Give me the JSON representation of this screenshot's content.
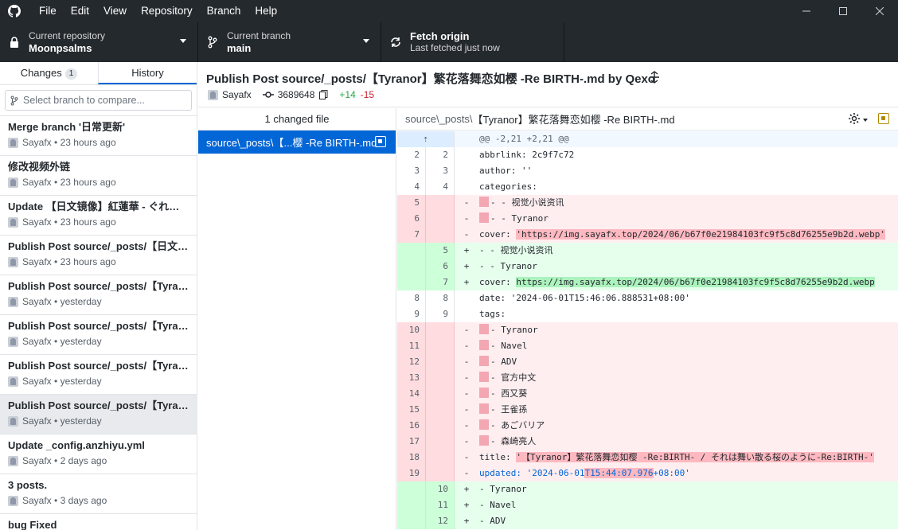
{
  "menu": {
    "items": [
      {
        "label": "File",
        "key": "F"
      },
      {
        "label": "Edit",
        "key": "E"
      },
      {
        "label": "View",
        "key": "V"
      },
      {
        "label": "Repository",
        "key": "R"
      },
      {
        "label": "Branch",
        "key": "B"
      },
      {
        "label": "Help",
        "key": "H"
      }
    ]
  },
  "toolbar": {
    "repo": {
      "desc": "Current repository",
      "value": "Moonpsalms"
    },
    "branch": {
      "desc": "Current branch",
      "value": "main"
    },
    "fetch": {
      "title": "Fetch origin",
      "desc": "Last fetched just now"
    }
  },
  "sidebar": {
    "tabs": [
      {
        "label": "Changes",
        "count": "1"
      },
      {
        "label": "History"
      }
    ],
    "selected_tab": "History",
    "branch_compare_placeholder": "Select branch to compare...",
    "commits": [
      {
        "summary": "Merge branch '日常更新'",
        "author": "Sayafx",
        "time": "23 hours ago"
      },
      {
        "summary": "修改视频外链",
        "author": "Sayafx",
        "time": "23 hours ago"
      },
      {
        "summary": "Update 【日文镜像】紅蓮華 - ぐれんか Gurenka…",
        "author": "Sayafx",
        "time": "23 hours ago"
      },
      {
        "summary": "Publish Post source/_posts/【日文镜像】…",
        "author": "Sayafx",
        "time": "23 hours ago"
      },
      {
        "summary": "Publish Post source/_posts/【Tyranor】…",
        "author": "Sayafx",
        "time": "yesterday"
      },
      {
        "summary": "Publish Post source/_posts/【Tyranor】…",
        "author": "Sayafx",
        "time": "yesterday"
      },
      {
        "summary": "Publish Post source/_posts/【Tyranor】…",
        "author": "Sayafx",
        "time": "yesterday"
      },
      {
        "summary": "Publish Post source/_posts/【Tyranor】…",
        "author": "Sayafx",
        "time": "yesterday",
        "selected": true
      },
      {
        "summary": "Update _config.anzhiyu.yml",
        "author": "Sayafx",
        "time": "2 days ago"
      },
      {
        "summary": "3 posts.",
        "author": "Sayafx",
        "time": "3 days ago"
      },
      {
        "summary": "bug Fixed",
        "author": "",
        "time": ""
      }
    ]
  },
  "commit": {
    "title": "Publish Post source/_posts/【Tyranor】繁花落舞恋如樱 -Re BIRTH-.md by Qexo",
    "author": "Sayafx",
    "sha": "3689648",
    "additions": "+14",
    "deletions": "-15"
  },
  "files": {
    "header": "1 changed file",
    "items": [
      {
        "name": "source\\_posts\\【...樱 -Re BIRTH-.md"
      }
    ]
  },
  "diff": {
    "path_dir": "source\\_posts\\",
    "path_file": "【Tyranor】繁花落舞恋如樱 -Re BIRTH-.md",
    "hunk": "@@ -2,21 +2,21 @@",
    "lines": [
      {
        "type": "ctx",
        "old": "2",
        "new": "2",
        "sym": "",
        "text": "abbrlink: 2c9f7c72"
      },
      {
        "type": "ctx",
        "old": "3",
        "new": "3",
        "sym": "",
        "text": "author: ''"
      },
      {
        "type": "ctx",
        "old": "4",
        "new": "4",
        "sym": "",
        "text": "categories:"
      },
      {
        "type": "del",
        "old": "5",
        "new": "",
        "sym": "-",
        "text": "- - 视觉小说资讯",
        "blank": true
      },
      {
        "type": "del",
        "old": "6",
        "new": "",
        "sym": "-",
        "text": "- - Tyranor",
        "blank": true
      },
      {
        "type": "del",
        "old": "7",
        "new": "",
        "sym": "-",
        "text": "cover: ",
        "hl": "'https://img.sayafx.top/2024/06/b67f0e21984103fc9f5c8d76255e9b2d.webp'"
      },
      {
        "type": "add",
        "old": "",
        "new": "5",
        "sym": "+",
        "text": "- - 视觉小说资讯"
      },
      {
        "type": "add",
        "old": "",
        "new": "6",
        "sym": "+",
        "text": "- - Tyranor"
      },
      {
        "type": "add",
        "old": "",
        "new": "7",
        "sym": "+",
        "text": "cover: ",
        "hl": "https://img.sayafx.top/2024/06/b67f0e21984103fc9f5c8d76255e9b2d.webp"
      },
      {
        "type": "ctx",
        "old": "8",
        "new": "8",
        "sym": "",
        "text": "date: '2024-06-01T15:46:06.888531+08:00'"
      },
      {
        "type": "ctx",
        "old": "9",
        "new": "9",
        "sym": "",
        "text": "tags:"
      },
      {
        "type": "del",
        "old": "10",
        "new": "",
        "sym": "-",
        "text": "- Tyranor",
        "blank": true
      },
      {
        "type": "del",
        "old": "11",
        "new": "",
        "sym": "-",
        "text": "- Navel",
        "blank": true
      },
      {
        "type": "del",
        "old": "12",
        "new": "",
        "sym": "-",
        "text": "- ADV",
        "blank": true
      },
      {
        "type": "del",
        "old": "13",
        "new": "",
        "sym": "-",
        "text": "- 官方中文",
        "blank": true
      },
      {
        "type": "del",
        "old": "14",
        "new": "",
        "sym": "-",
        "text": "- 西又葵",
        "blank": true
      },
      {
        "type": "del",
        "old": "15",
        "new": "",
        "sym": "-",
        "text": "- 王雀孫",
        "blank": true
      },
      {
        "type": "del",
        "old": "16",
        "new": "",
        "sym": "-",
        "text": "- あごバリア",
        "blank": true
      },
      {
        "type": "del",
        "old": "17",
        "new": "",
        "sym": "-",
        "text": "- 森崎亮人",
        "blank": true
      },
      {
        "type": "del",
        "old": "18",
        "new": "",
        "sym": "-",
        "text": "title: ",
        "hl": "'【Tyranor】繁花落舞恋如樱 -Re:BIRTH- / それは舞い散る桜のように-Re:BIRTH-'"
      },
      {
        "type": "del upd",
        "old": "19",
        "new": "",
        "sym": "-",
        "text": "updated: '2024-06-01",
        "hl": "T15:44:07.976",
        "tail": "+08:00'"
      },
      {
        "type": "add",
        "old": "",
        "new": "10",
        "sym": "+",
        "text": "- Tyranor"
      },
      {
        "type": "add",
        "old": "",
        "new": "11",
        "sym": "+",
        "text": "- Navel"
      },
      {
        "type": "add",
        "old": "",
        "new": "12",
        "sym": "+",
        "text": "- ADV"
      }
    ]
  },
  "colors": {
    "chrome": "#24292e",
    "accent": "#0366d6",
    "added": "#28a745",
    "removed": "#cb2431"
  }
}
